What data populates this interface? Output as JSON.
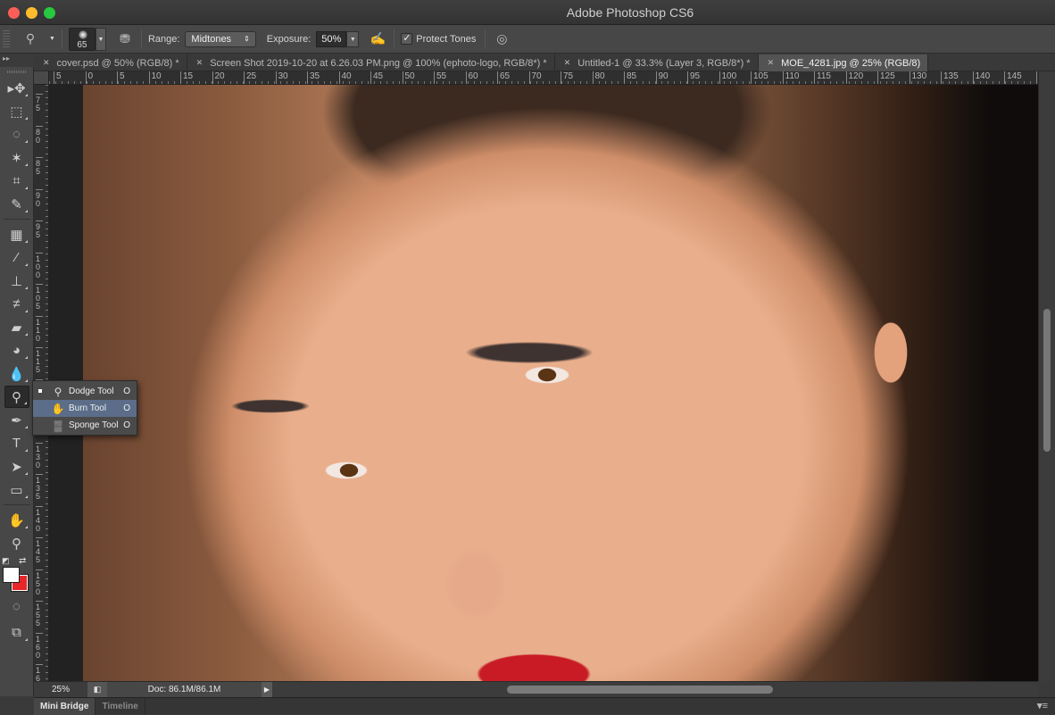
{
  "window": {
    "title": "Adobe Photoshop CS6"
  },
  "options_bar": {
    "tool_icon": "dodge-tool-icon",
    "brush_size": "65",
    "range_label": "Range:",
    "range_value": "Midtones",
    "exposure_label": "Exposure:",
    "exposure_value": "50%",
    "airbrush_icon": "airbrush-icon",
    "protect_tones_label": "Protect Tones",
    "protect_tones_checked": true,
    "pressure_icon": "pressure-size-icon"
  },
  "panel_collapse_label": "▸▸",
  "tabs": [
    {
      "label": "cover.psd @ 50% (RGB/8) *",
      "active": false
    },
    {
      "label": "Screen Shot 2019-10-20 at 6.26.03 PM.png @ 100% (ephoto-logo, RGB/8*) *",
      "active": false
    },
    {
      "label": "Untitled-1 @ 33.3% (Layer 3, RGB/8*) *",
      "active": false
    },
    {
      "label": "MOE_4281.jpg @ 25% (RGB/8)",
      "active": true
    }
  ],
  "ruler_h": [
    "5",
    "0",
    "5",
    "10",
    "15",
    "20",
    "25",
    "30",
    "35",
    "40",
    "45",
    "50",
    "55",
    "60",
    "65",
    "70",
    "75",
    "80",
    "85",
    "90",
    "95",
    "100",
    "105",
    "110",
    "115",
    "120",
    "125",
    "130",
    "135",
    "140",
    "145",
    "1"
  ],
  "ruler_v": [
    "75",
    "80",
    "85",
    "90",
    "95",
    "100",
    "105",
    "110",
    "115",
    "120",
    "125",
    "130",
    "135",
    "140",
    "145",
    "150",
    "155",
    "160",
    "16"
  ],
  "tools": [
    {
      "name": "move-tool",
      "glyph": "▸✥"
    },
    {
      "name": "marquee-tool",
      "glyph": "⬚"
    },
    {
      "name": "lasso-tool",
      "glyph": "◌"
    },
    {
      "name": "magic-wand-tool",
      "glyph": "✶"
    },
    {
      "name": "crop-tool",
      "glyph": "⌗"
    },
    {
      "name": "eyedropper-tool",
      "glyph": "✎"
    },
    {
      "name": "healing-brush-tool",
      "glyph": "▦"
    },
    {
      "name": "brush-tool",
      "glyph": "⁄"
    },
    {
      "name": "clone-stamp-tool",
      "glyph": "⊥"
    },
    {
      "name": "history-brush-tool",
      "glyph": "≠"
    },
    {
      "name": "eraser-tool",
      "glyph": "▰"
    },
    {
      "name": "paint-bucket-tool",
      "glyph": "◕"
    },
    {
      "name": "blur-tool",
      "glyph": "💧"
    },
    {
      "name": "dodge-tool",
      "glyph": "⚲"
    },
    {
      "name": "pen-tool",
      "glyph": "✒"
    },
    {
      "name": "type-tool",
      "glyph": "T"
    },
    {
      "name": "path-selection-tool",
      "glyph": "➤"
    },
    {
      "name": "rectangle-tool",
      "glyph": "▭"
    },
    {
      "name": "hand-tool",
      "glyph": "✋"
    },
    {
      "name": "zoom-tool",
      "glyph": "⚲"
    }
  ],
  "flyout": [
    {
      "label": "Dodge Tool",
      "shortcut": "O",
      "selected": true,
      "highlighted": false,
      "icon": "dodge-icon",
      "glyph": "⚲"
    },
    {
      "label": "Burn Tool",
      "shortcut": "O",
      "selected": false,
      "highlighted": true,
      "icon": "burn-icon",
      "glyph": "✋"
    },
    {
      "label": "Sponge Tool",
      "shortcut": "O",
      "selected": false,
      "highlighted": false,
      "icon": "sponge-icon",
      "glyph": "▒"
    }
  ],
  "colors": {
    "foreground": "#ffffff",
    "background": "#e8262a",
    "highlight": "#5b6d89"
  },
  "status": {
    "zoom": "25%",
    "doc": "Doc: 86.1M/86.1M"
  },
  "bottom_panel": {
    "tabs": [
      "Mini Bridge",
      "Timeline"
    ],
    "active": "Mini Bridge"
  }
}
